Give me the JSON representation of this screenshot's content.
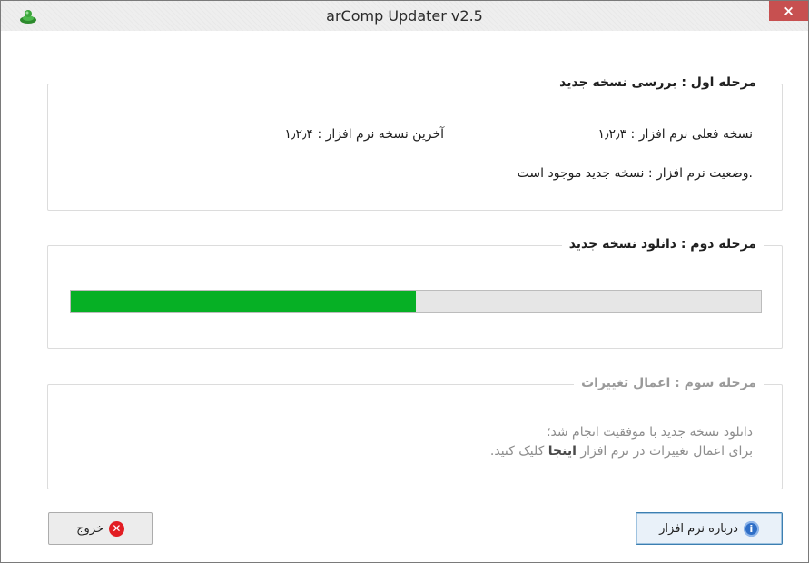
{
  "window": {
    "title": "arComp Updater v2.5",
    "close_label": "×"
  },
  "step1": {
    "legend": "مرحله اول : بررسی نسخه جدید",
    "current_version": "نسخه فعلی نرم افزار : ۱٫۲٫۳",
    "latest_version": "آخرین نسخه نرم افزار : ۱٫۲٫۴",
    "status": ".وضعیت نرم افزار : نسخه جدید موجود است"
  },
  "step2": {
    "legend": "مرحله دوم : دانلود نسخه جدید",
    "progress_fraction": 0.5
  },
  "step3": {
    "legend": "مرحله سوم : اعمال تغییرات",
    "line1": "دانلود نسخه جدید با موفقیت انجام شد؛",
    "line2_prefix": "برای اعمال تغییرات در نرم افزار ",
    "line2_link": "اینجا",
    "line2_suffix": " کلیک کنید."
  },
  "buttons": {
    "about_label": "درباره نرم افزار",
    "exit_label": "خروج"
  },
  "icons": {
    "app": "green-disc-icon",
    "about": "info-icon",
    "exit": "error-x-icon"
  },
  "colors": {
    "progress_fill": "#06b025",
    "progress_track": "#e6e6e6",
    "close_button": "#c75050",
    "info_icon": "#2f6fc7",
    "exit_icon": "#e21d23",
    "disabled_text": "#8d8d8d"
  }
}
